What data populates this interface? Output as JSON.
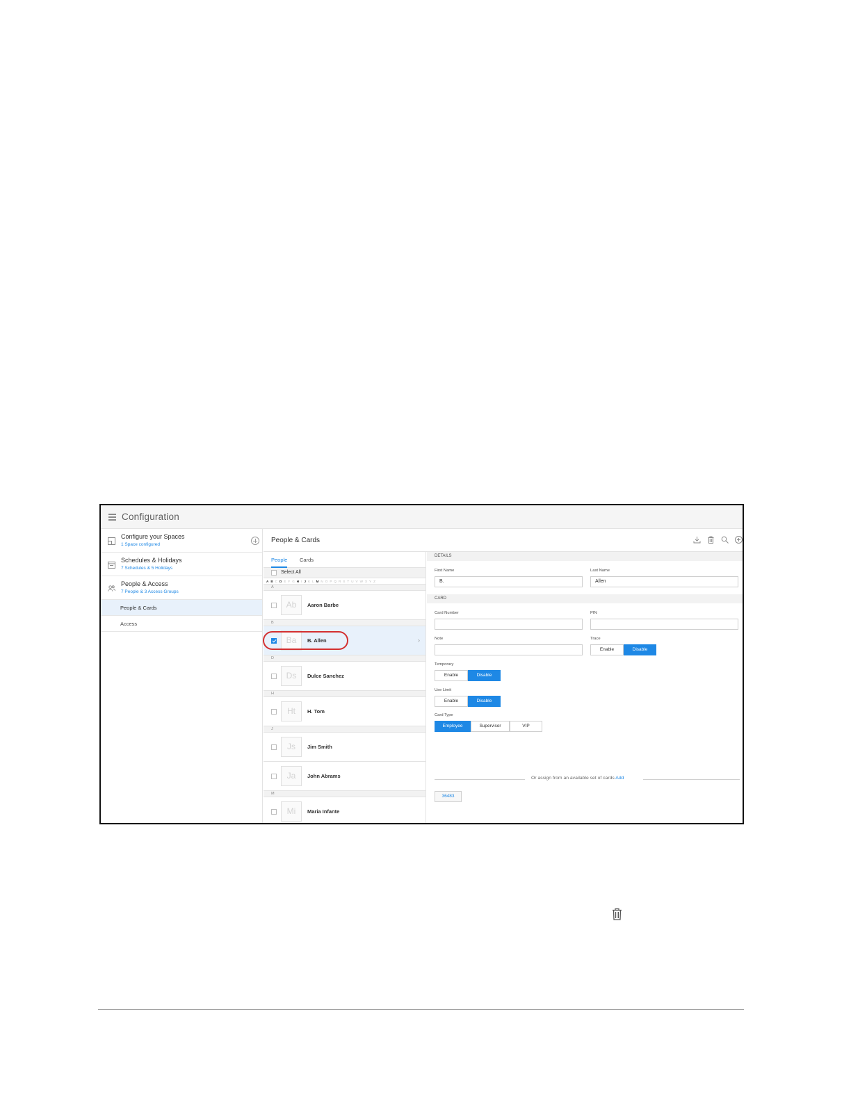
{
  "app": {
    "title": "Configuration"
  },
  "nav": {
    "items": [
      {
        "title": "Configure your Spaces",
        "subtitle": "1 Space configured",
        "icon": "space-icon"
      },
      {
        "title": "Schedules & Holidays",
        "subtitle": "7 Schedules & 5 Holidays",
        "icon": "calendar-icon"
      },
      {
        "title": "People & Access",
        "subtitle": "7 People & 3 Access Groups",
        "icon": "people-icon"
      }
    ],
    "subitems": [
      {
        "label": "People & Cards",
        "active": true
      },
      {
        "label": "Access",
        "active": false
      }
    ]
  },
  "main": {
    "title": "People & Cards",
    "tools": [
      "download-icon",
      "trash-icon",
      "search-icon",
      "add-icon"
    ]
  },
  "list": {
    "tabs": [
      "People",
      "Cards"
    ],
    "select_all": "Select All",
    "alphabet": [
      "A",
      "B",
      "C",
      "D",
      "E",
      "F",
      "G",
      "H",
      "I",
      "J",
      "K",
      "L",
      "M",
      "N",
      "O",
      "P",
      "Q",
      "R",
      "S",
      "T",
      "U",
      "V",
      "W",
      "X",
      "Y",
      "Z"
    ],
    "groups": {
      "a": "A",
      "b": "B",
      "d": "D",
      "h": "H",
      "j": "J",
      "m": "M"
    },
    "people": [
      {
        "initials": "Ab",
        "name": "Aaron Barbe",
        "checked": false
      },
      {
        "initials": "Ba",
        "name": "B. Allen",
        "checked": true
      },
      {
        "initials": "Ds",
        "name": "Dulce Sanchez",
        "checked": false
      },
      {
        "initials": "Ht",
        "name": "H. Tom",
        "checked": false
      },
      {
        "initials": "Js",
        "name": "Jim Smith",
        "checked": false
      },
      {
        "initials": "Ja",
        "name": "John Abrams",
        "checked": false
      },
      {
        "initials": "Mi",
        "name": "Maria Infante",
        "checked": false
      }
    ]
  },
  "details": {
    "section_details": "DETAILS",
    "first_name_label": "First Name",
    "first_name": "B.",
    "last_name_label": "Last Name",
    "last_name": "Allen",
    "section_card": "CARD",
    "card_number_label": "Card Number",
    "card_number": "",
    "pin_label": "PIN",
    "pin": "",
    "note_label": "Note",
    "note": "",
    "trace_label": "Trace",
    "temporary_label": "Temporary",
    "use_limit_label": "Use Limit",
    "card_type_label": "Card Type",
    "enable": "Enable",
    "disable": "Disable",
    "card_types": [
      "Employee",
      "Supervisor",
      "VIP"
    ],
    "assign_text": "Or assign from an available set of cards",
    "assign_link": "Add",
    "available_card": "36483"
  },
  "colors": {
    "accent": "#1e88e5",
    "highlight": "#d32f2f"
  }
}
